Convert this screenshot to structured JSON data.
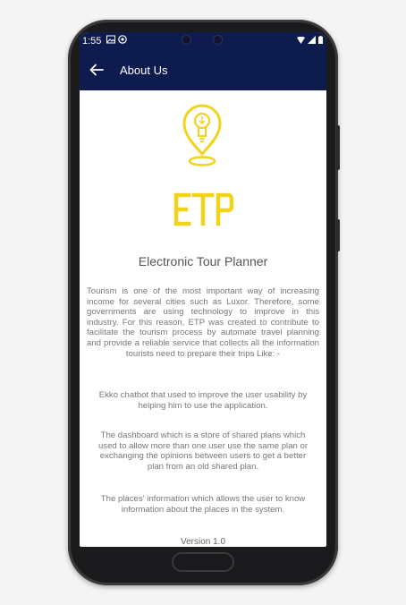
{
  "status_bar": {
    "time": "1:55"
  },
  "header": {
    "title": "About Us",
    "back_icon": "arrow-left-icon"
  },
  "brand": {
    "logo_text": "ETP",
    "accent_color": "#f2d31b",
    "header_color": "#0d1b4f"
  },
  "content": {
    "app_name": "Electronic Tour Planner",
    "intro": "Tourism is one of the most important way of increasing income for several cities such as Luxor. Therefore, some governments are using technology to improve in this industry. For this reason, ETP was created to contribute to facilitate the tourism process by automate travel planning and provide a reliable service that collects all the information tourists need to prepare their trips Like: -",
    "feature_ekko": "Ekko chatbot that used to improve the user usability by helping him to use the application.",
    "feature_dashboard": "The dashboard which is a store of shared plans which used to allow more than one user use the same plan or exchanging the opinions between users to get a better plan from an old shared plan.",
    "feature_places": "The places' information which allows the user to know information about the places in the system.",
    "version": "Version 1.0"
  }
}
